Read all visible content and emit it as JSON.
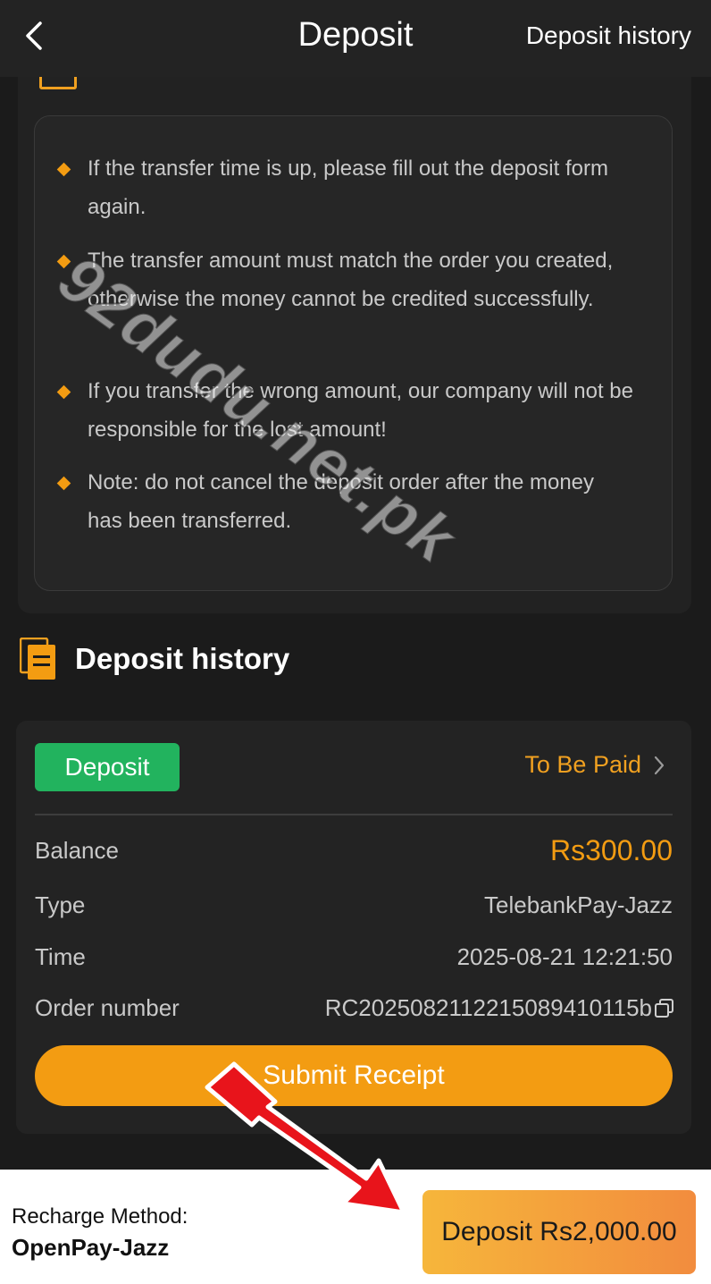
{
  "header": {
    "title": "Deposit",
    "history_link": "Deposit history"
  },
  "rules": [
    "If the transfer time is up, please fill out the deposit form again.",
    "The transfer amount must match the order you created, otherwise the money cannot be credited successfully.",
    "If you transfer the wrong amount, our company will not be responsible for the lost amount!",
    "Note: do not cancel the deposit order after the money has been transferred."
  ],
  "history": {
    "title": "Deposit history",
    "badge": "Deposit",
    "status": "To Be Paid",
    "rows": {
      "balance_label": "Balance",
      "balance_value": "Rs300.00",
      "type_label": "Type",
      "type_value": "TelebankPay-Jazz",
      "time_label": "Time",
      "time_value": "2025-08-21 12:21:50",
      "order_label": "Order number",
      "order_value": "RC2025082112215089410115b"
    },
    "submit_label": "Submit Receipt"
  },
  "footer": {
    "method_label": "Recharge Method:",
    "method_value": "OpenPay-Jazz",
    "deposit_button": "Deposit Rs2,000.00"
  },
  "watermark": "92dudu.net.pk",
  "colors": {
    "accent": "#f39c12",
    "badge_green": "#22b35e",
    "background": "#1b1b1b",
    "arrow_red": "#e8141b"
  },
  "icons": {
    "back": "chevron-left-icon",
    "status_arrow": "chevron-right-icon",
    "copy": "copy-icon",
    "history": "document-stack-icon"
  }
}
